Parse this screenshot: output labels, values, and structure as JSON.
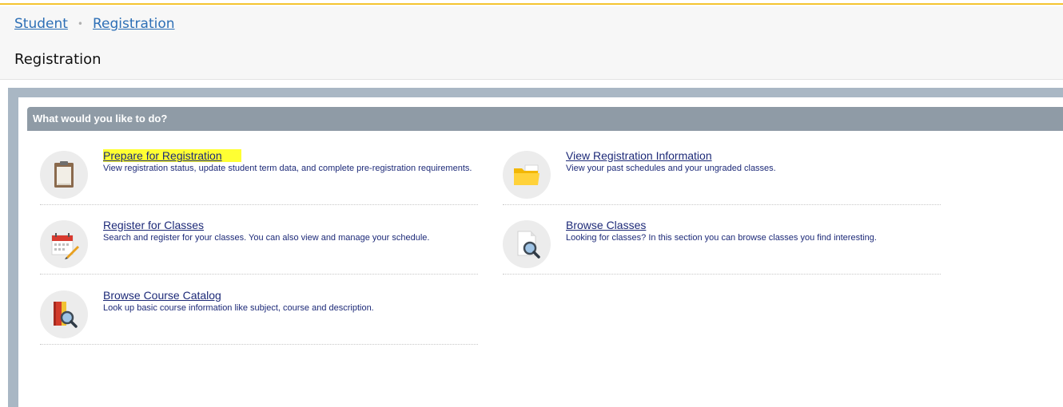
{
  "breadcrumb": {
    "items": [
      "Student",
      "Registration"
    ],
    "separator": "•"
  },
  "page_title": "Registration",
  "panel": {
    "header": "What would you like to do?",
    "items": [
      {
        "title": "Prepare for Registration",
        "description": "View registration status, update student term data, and complete pre-registration requirements.",
        "icon": "clipboard-icon",
        "highlighted": true
      },
      {
        "title": "View Registration Information",
        "description": "View your past schedules and your ungraded classes.",
        "icon": "folder-icon"
      },
      {
        "title": "Register for Classes",
        "description": "Search and register for your classes. You can also view and manage your schedule.",
        "icon": "calendar-pencil-icon"
      },
      {
        "title": "Browse Classes",
        "description": "Looking for classes? In this section you can browse classes you find interesting.",
        "icon": "document-search-icon"
      },
      {
        "title": "Browse Course Catalog",
        "description": "Look up basic course information like subject, course and description.",
        "icon": "book-search-icon"
      }
    ]
  },
  "colors": {
    "accent_border": "#f4c430",
    "link": "#2d6fb6",
    "item_text": "#1d2a78",
    "panel_header_bg": "#8f9ba6",
    "highlight": "#ffff33"
  }
}
